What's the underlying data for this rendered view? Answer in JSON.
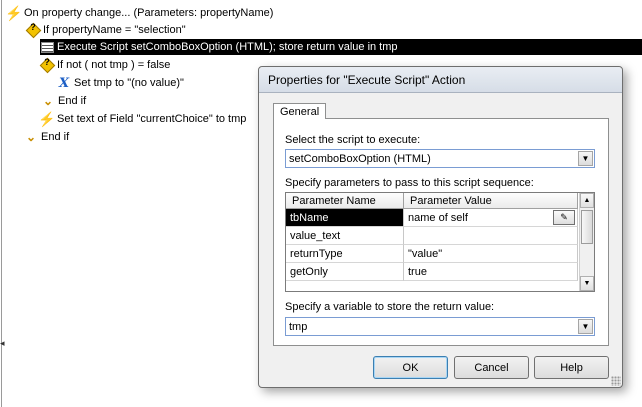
{
  "tree": {
    "rows": [
      {
        "text": "On property change... (Parameters: propertyName)",
        "icon": "bolt-icon"
      },
      {
        "text": "If propertyName = \"selection\"",
        "icon": "if-diamond-icon"
      },
      {
        "text": "Execute Script setComboBoxOption (HTML); store return value in tmp",
        "icon": "script-icon"
      },
      {
        "text": "If not ( not tmp ) = false",
        "icon": "if-diamond-icon"
      },
      {
        "text": "Set tmp to \"(no value)\"",
        "icon": "set-variable-icon"
      },
      {
        "text": "End if",
        "icon": "end-if-icon"
      },
      {
        "text": "Set text of Field \"currentChoice\" to tmp",
        "icon": "bolt-icon"
      },
      {
        "text": "End if",
        "icon": "end-if-icon"
      }
    ]
  },
  "dialog": {
    "title": "Properties for \"Execute Script\" Action",
    "tab": "General",
    "script_label": "Select the script to execute:",
    "script_value": "setComboBoxOption (HTML)",
    "params_label": "Specify parameters to pass to this script sequence:",
    "params": {
      "headers": [
        "Parameter Name",
        "Parameter Value"
      ],
      "rows": [
        {
          "name": "tbName",
          "value": "name of self"
        },
        {
          "name": "value_text",
          "value": ""
        },
        {
          "name": "returnType",
          "value": "\"value\""
        },
        {
          "name": "getOnly",
          "value": "true"
        }
      ]
    },
    "variable_label": "Specify a variable to store the return value:",
    "variable_value": "tmp",
    "buttons": {
      "ok": "OK",
      "cancel": "Cancel",
      "help": "Help"
    }
  }
}
